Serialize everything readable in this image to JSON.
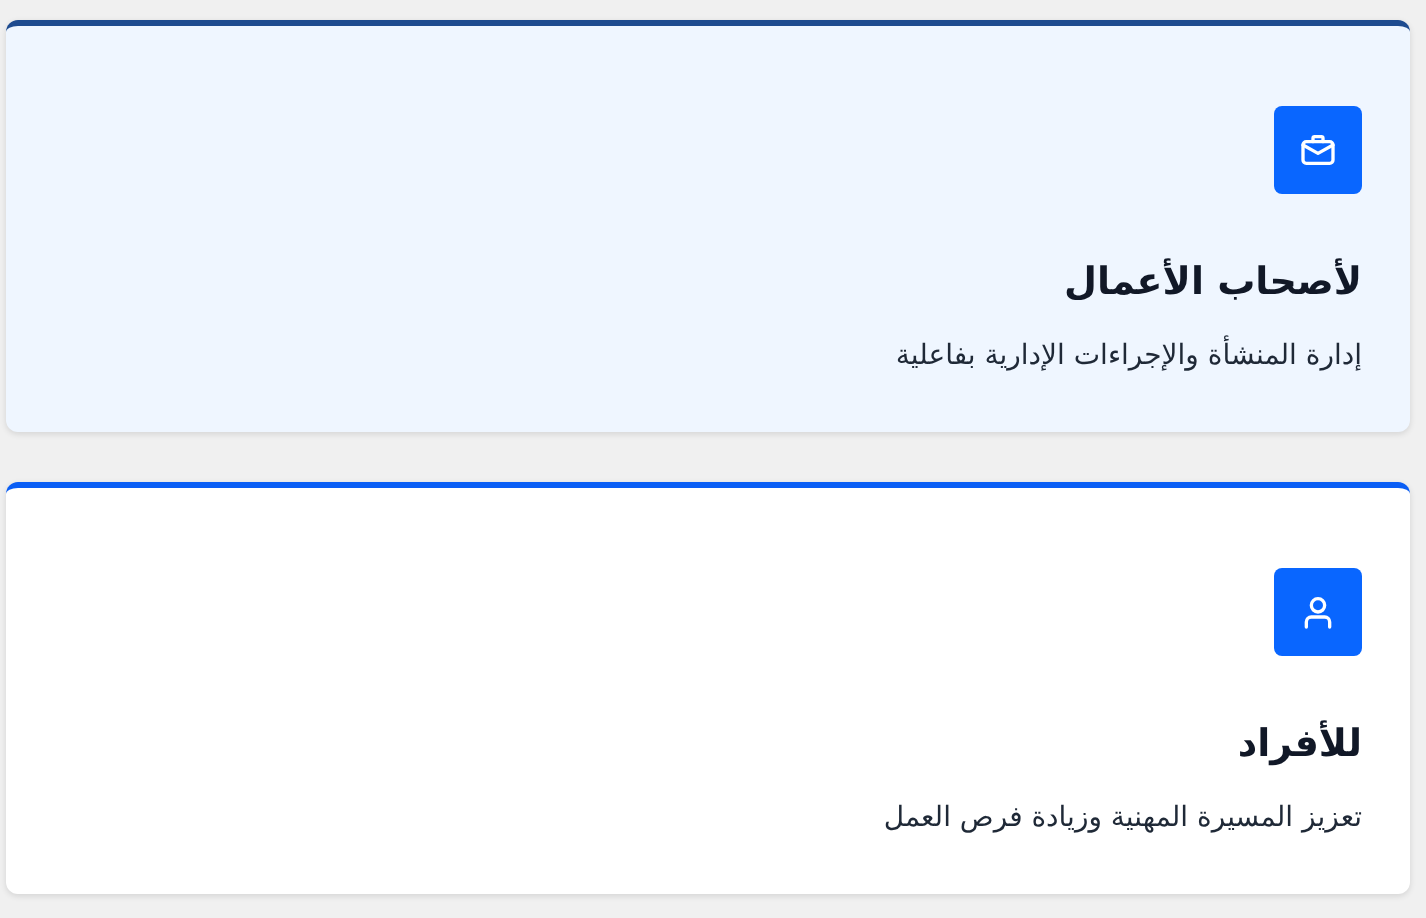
{
  "cards": [
    {
      "title": "لأصحاب الأعمال",
      "description": "إدارة المنشأة والإجراءات الإدارية بفاعلية",
      "selected": true
    },
    {
      "title": "للأفراد",
      "description": "تعزيز المسيرة المهنية وزيادة فرص العمل",
      "selected": false
    }
  ]
}
